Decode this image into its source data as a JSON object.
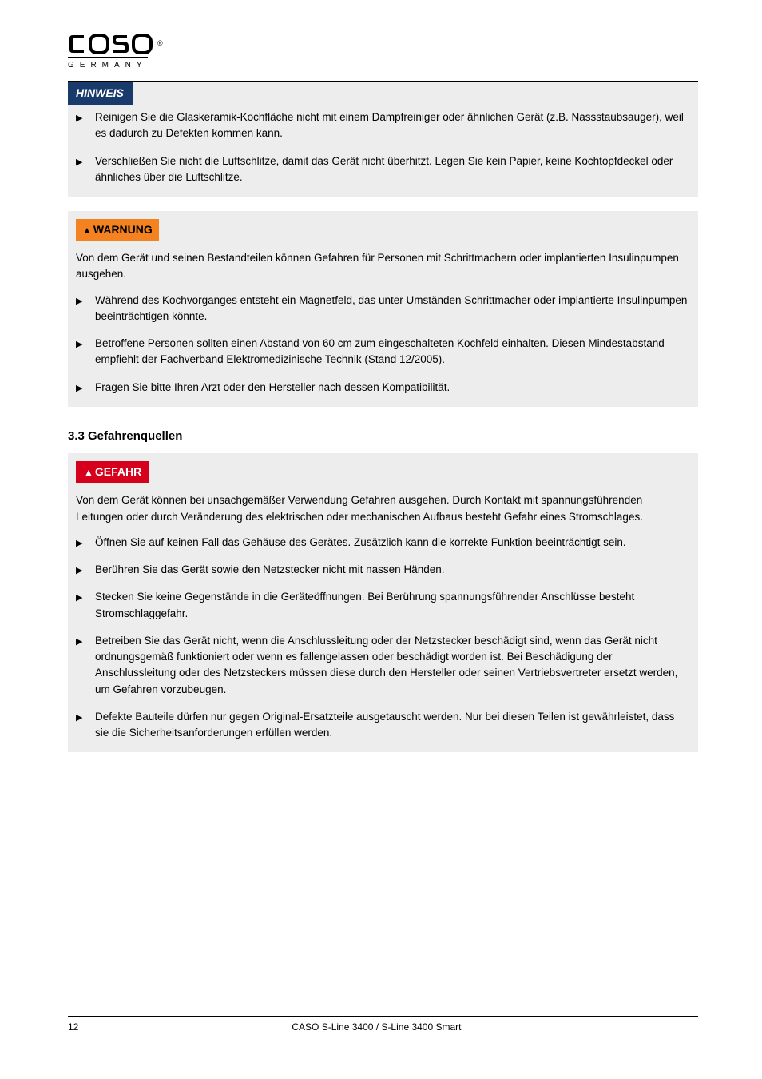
{
  "logo": {
    "brand_letters": "caso",
    "registered": "®",
    "subtitle": "GERMANY"
  },
  "box1": {
    "label": "HINWEIS",
    "items": [
      "Reinigen Sie die Glaskeramik-Kochfläche nicht mit einem Dampfreiniger oder ähnlichen Gerät (z.B. Nassstaubsauger), weil es dadurch zu Defekten kommen kann.",
      "Verschließen Sie nicht die Luftschlitze, damit das Gerät nicht überhitzt. Legen Sie kein Papier, keine Kochtopfdeckel oder ähnliches über die Luftschlitze."
    ]
  },
  "box2": {
    "label": "WARNUNG",
    "lead": "Von dem Gerät und seinen Bestandteilen können Gefahren für Personen mit Schrittmachern oder implantierten Insulinpumpen ausgehen.",
    "items": [
      "Während des Kochvorganges entsteht ein Magnetfeld, das unter Umständen Schrittmacher oder implantierte Insulinpumpen beeinträchtigen könnte.",
      "Betroffene Personen sollten einen Abstand von 60 cm zum eingeschalteten Kochfeld einhalten. Diesen Mindestabstand empfiehlt der Fachverband Elektromedizinische Technik (Stand 12/2005).",
      "Fragen Sie bitte Ihren Arzt oder den Hersteller nach dessen Kompatibilität."
    ]
  },
  "heading": "3.3   Gefahrenquellen",
  "box3": {
    "label": "GEFAHR",
    "lead": "Von dem Gerät können bei unsachgemäßer Verwendung Gefahren ausgehen. Durch Kontakt mit spannungsführenden Leitungen oder durch Veränderung des elektrischen oder mechanischen Aufbaus besteht Gefahr eines Stromschlages.",
    "items": [
      "Öffnen Sie auf keinen Fall das Gehäuse des Gerätes. Zusätzlich kann die korrekte Funktion beeinträchtigt sein.",
      "Berühren Sie das Gerät sowie den Netzstecker nicht mit nassen Händen.",
      "Stecken Sie keine Gegenstände in die Geräteöffnungen. Bei Berührung spannungsführender Anschlüsse besteht Stromschlaggefahr.",
      "Betreiben Sie das Gerät nicht, wenn die Anschlussleitung oder der Netzstecker beschädigt sind, wenn das Gerät nicht ordnungsgemäß funktioniert oder wenn es fallengelassen oder beschädigt worden ist. Bei Beschädigung der Anschlussleitung oder des Netzsteckers müssen diese durch den Hersteller oder seinen Vertriebsvertreter ersetzt werden, um Gefahren vorzubeugen.",
      "Defekte Bauteile dürfen nur gegen Original-Ersatzteile ausgetauscht werden. Nur bei diesen Teilen ist gewährleistet, dass sie die Sicherheitsanforderungen erfüllen werden."
    ]
  },
  "footer": {
    "page": "12",
    "product": "CASO S-Line 3400 / S-Line 3400 Smart"
  }
}
